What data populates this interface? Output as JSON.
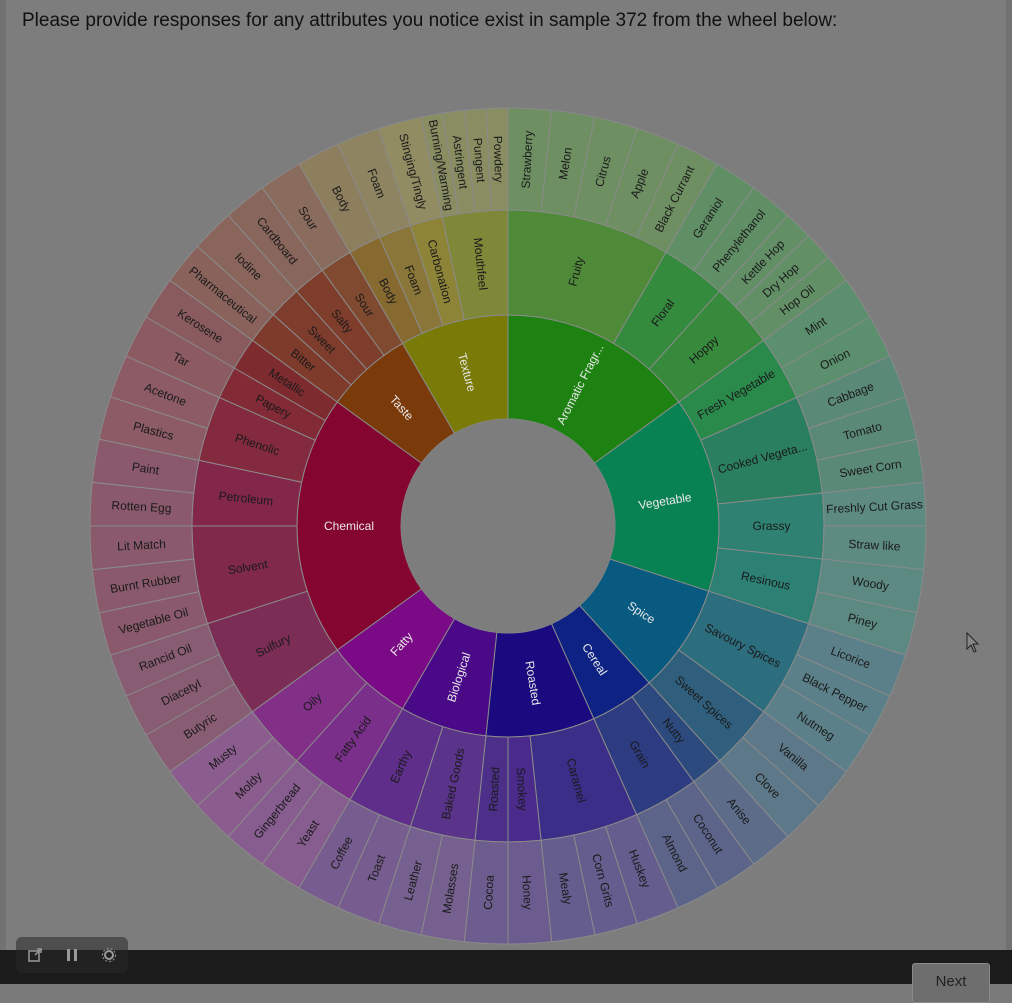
{
  "prompt": "Please provide responses for any attributes you notice exist in sample 372 from the wheel below:",
  "next_label": "Next",
  "wheel": {
    "start_angle": 0,
    "inner": [
      {
        "label": "Aromatic Fragr...",
        "span": 54,
        "color": "#1d8212",
        "mid": [
          {
            "label": "Fruity",
            "span": 30,
            "color": "#4e8a38",
            "outer": [
              "Strawberry",
              "Melon",
              "Citrus",
              "Apple",
              "Black Currant"
            ]
          },
          {
            "label": "Floral",
            "span": 12,
            "color": "#348a3d",
            "outer": [
              "Geraniol",
              "Phenylethanol"
            ]
          },
          {
            "label": "Hoppy",
            "span": 12,
            "color": "#378a3c",
            "outer": [
              "Kettle Hop",
              "Dry Hop",
              "Hop Oil"
            ]
          }
        ]
      },
      {
        "label": "Vegetable",
        "span": 54,
        "color": "#098253",
        "mid": [
          {
            "label": "Fresh Vegetable",
            "span": 12,
            "color": "#2a8a4c",
            "outer": [
              "Mint",
              "Onion"
            ]
          },
          {
            "label": "Cooked Vegeta...",
            "span": 18,
            "color": "#2a7f60",
            "outer": [
              "Cabbage",
              "Tomato",
              "Sweet Corn"
            ]
          },
          {
            "label": "Grassy",
            "span": 12,
            "color": "#2f8272",
            "outer": [
              "Freshly Cut Grass",
              "Straw like"
            ]
          },
          {
            "label": "Resinous",
            "span": 12,
            "color": "#2c8074",
            "outer": [
              "Woody",
              "Piney"
            ]
          }
        ]
      },
      {
        "label": "Spice",
        "span": 30,
        "color": "#085a80",
        "mid": [
          {
            "label": "Savoury Spices",
            "span": 18,
            "color": "#2d6e7e",
            "outer": [
              "Licorice",
              "Black Pepper",
              "Nutmeg"
            ]
          },
          {
            "label": "Sweet Spices",
            "span": 12,
            "color": "#2f5f7c",
            "outer": [
              "Vanilla",
              "Clove"
            ]
          }
        ]
      },
      {
        "label": "Cereal",
        "span": 18,
        "color": "#0d2283",
        "mid": [
          {
            "label": "Nutty",
            "span": 6,
            "color": "#2c4a7e",
            "outer": [
              "Anise"
            ]
          },
          {
            "label": "Grain",
            "span": 12,
            "color": "#2d3b80",
            "outer": [
              "Coconut",
              "Almond"
            ]
          }
        ]
      },
      {
        "label": "Roasted",
        "span": 30,
        "color": "#1a0a80",
        "mid": [
          {
            "label": "Caramel",
            "span": 18,
            "color": "#3b2e88",
            "outer": [
              "Huskey",
              "Corn Grits",
              "Mealy"
            ]
          },
          {
            "label": "Smokey",
            "span": 6,
            "color": "#4a2a8a",
            "outer": [
              "Honey"
            ]
          },
          {
            "label": "Roasted",
            "span": 6,
            "color": "#4c2f88",
            "outer": [
              "Cocoa"
            ]
          }
        ]
      },
      {
        "label": "Biological",
        "span": 24,
        "color": "#4a0a88",
        "mid": [
          {
            "label": "Baked Goods",
            "span": 12,
            "color": "#5a348a",
            "outer": [
              "Molasses",
              "Leather"
            ]
          },
          {
            "label": "Earthy",
            "span": 12,
            "color": "#5e2e8a",
            "outer": [
              "Toast",
              "Coffee"
            ]
          }
        ]
      },
      {
        "label": "Fatty",
        "span": 24,
        "color": "#7a0a86",
        "mid": [
          {
            "label": "Fatty Acid",
            "span": 12,
            "color": "#7a2f8a",
            "outer": [
              "Yeast",
              "Gingerbread"
            ]
          },
          {
            "label": "Oily",
            "span": 12,
            "color": "#822f88",
            "outer": [
              "Moldy",
              "Musty"
            ]
          }
        ]
      },
      {
        "label": "Chemical",
        "span": 72,
        "color": "#84052f",
        "mid": [
          {
            "label": "Sulfury",
            "span": 18,
            "color": "#7c2d56",
            "outer": [
              "Butyric",
              "Diacetyl",
              "Rancid Oil"
            ]
          },
          {
            "label": "Solvent",
            "span": 18,
            "color": "#80294a",
            "outer": [
              "Vegetable Oil",
              "Burnt Rubber",
              "Lit Match"
            ]
          },
          {
            "label": "Petroleum",
            "span": 12,
            "color": "#82274a",
            "outer": [
              "Rotten Egg",
              "Paint"
            ]
          },
          {
            "label": "Phenolic",
            "span": 12,
            "color": "#832a3e",
            "outer": [
              "Plastics",
              "Acetone"
            ]
          },
          {
            "label": "Papery",
            "span": 6,
            "color": "#822b36",
            "outer": [
              "Tar"
            ]
          },
          {
            "label": "Metallic",
            "span": 6,
            "color": "#7e2b30",
            "outer": [
              "Kerosene"
            ]
          }
        ]
      },
      {
        "label": "Taste",
        "span": 24,
        "color": "#7a3a0a",
        "mid": [
          {
            "label": "Bitter",
            "span": 6,
            "color": "#7e3a2a",
            "outer": [
              "Pharmaceutical"
            ]
          },
          {
            "label": "Sweet",
            "span": 6,
            "color": "#7e3c2c",
            "outer": [
              "Iodine"
            ]
          },
          {
            "label": "Salty",
            "span": 6,
            "color": "#7f3e2c",
            "outer": [
              "Cardboard"
            ]
          },
          {
            "label": "Sour",
            "span": 6,
            "color": "#804a30",
            "outer": [
              "Sour"
            ]
          }
        ]
      },
      {
        "label": "Texture",
        "span": 30,
        "color": "#7a7a08",
        "mid": [
          {
            "label": "Body",
            "span": 6,
            "color": "#866a30",
            "outer": [
              "Body"
            ]
          },
          {
            "label": "Foam",
            "span": 6,
            "color": "#8a7638",
            "outer": [
              "Foam"
            ]
          },
          {
            "label": "Carbonation",
            "span": 6,
            "color": "#8e8438",
            "outer": [
              "Stinging/Tingly"
            ]
          },
          {
            "label": "Mouthfeel",
            "span": 12,
            "color": "#7f8838",
            "outer": [
              "Burning/Warming",
              "Astringent",
              "Pungent",
              "Powdery"
            ]
          }
        ]
      }
    ]
  }
}
